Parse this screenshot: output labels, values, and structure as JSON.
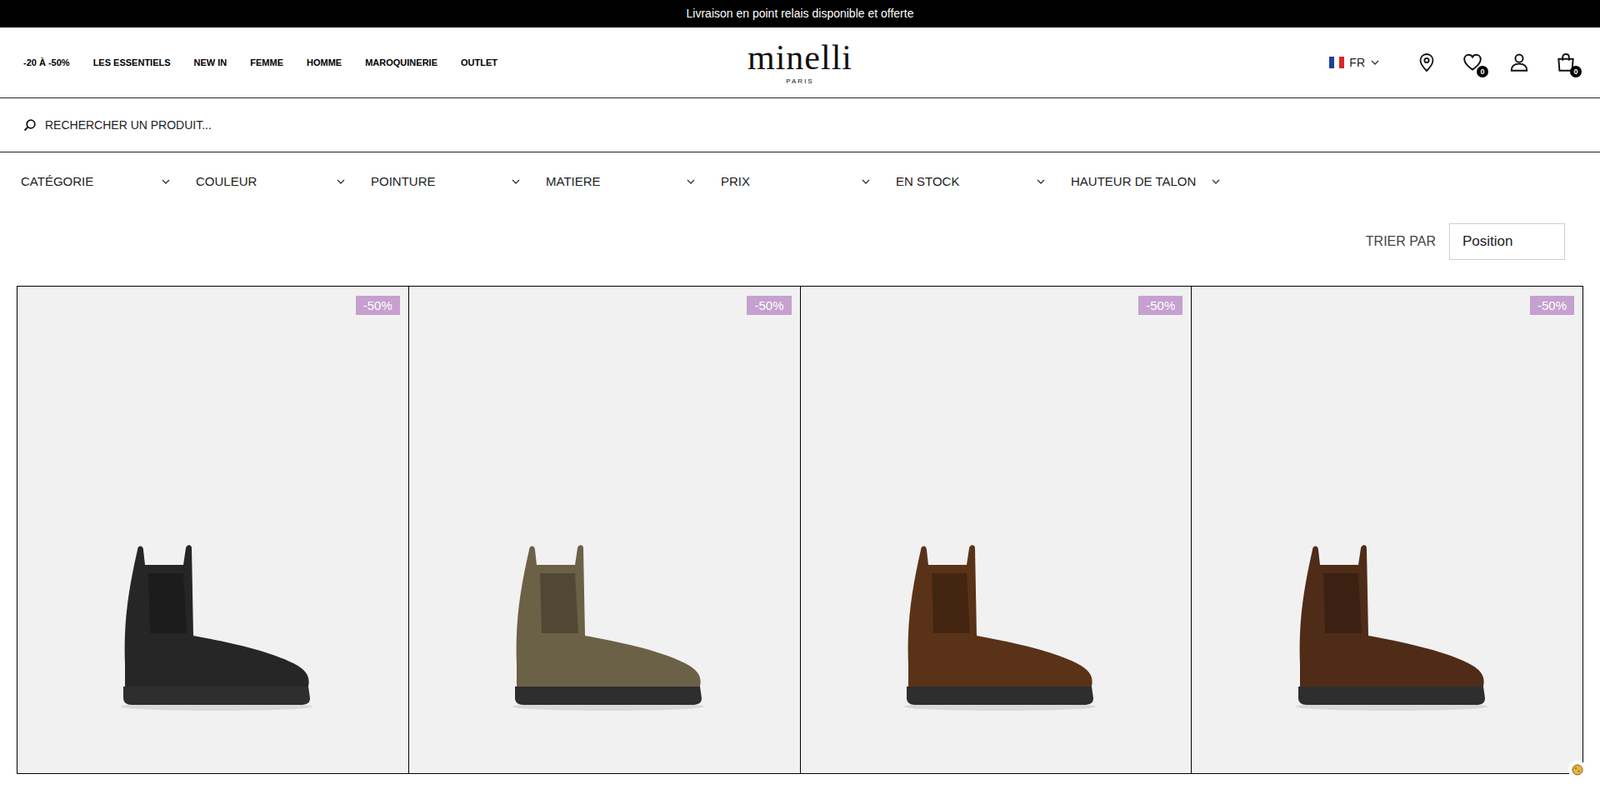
{
  "announcement": "Livraison en point relais disponible et offerte",
  "nav": [
    {
      "label": "-20 À -50%"
    },
    {
      "label": "LES ESSENTIELS"
    },
    {
      "label": "NEW IN"
    },
    {
      "label": "FEMME"
    },
    {
      "label": "HOMME"
    },
    {
      "label": "MAROQUINERIE"
    },
    {
      "label": "OUTLET"
    }
  ],
  "logo": {
    "name": "minelli",
    "tagline": "PARIS"
  },
  "header_actions": {
    "language": "FR",
    "wishlist_count": "0",
    "cart_count": "0"
  },
  "search": {
    "placeholder": "RECHERCHER UN PRODUIT..."
  },
  "filters": [
    {
      "label": "CATÉGORIE"
    },
    {
      "label": "COULEUR"
    },
    {
      "label": "POINTURE"
    },
    {
      "label": "MATIERE"
    },
    {
      "label": "PRIX"
    },
    {
      "label": "EN STOCK"
    },
    {
      "label": "HAUTEUR DE TALON"
    }
  ],
  "sort": {
    "label": "TRIER PAR",
    "value": "Position"
  },
  "products": [
    {
      "badge": "-50%",
      "color": "#262626"
    },
    {
      "badge": "-50%",
      "color": "#6b6147"
    },
    {
      "badge": "-50%",
      "color": "#5a3218"
    },
    {
      "badge": "-50%",
      "color": "#4f2c18"
    }
  ]
}
